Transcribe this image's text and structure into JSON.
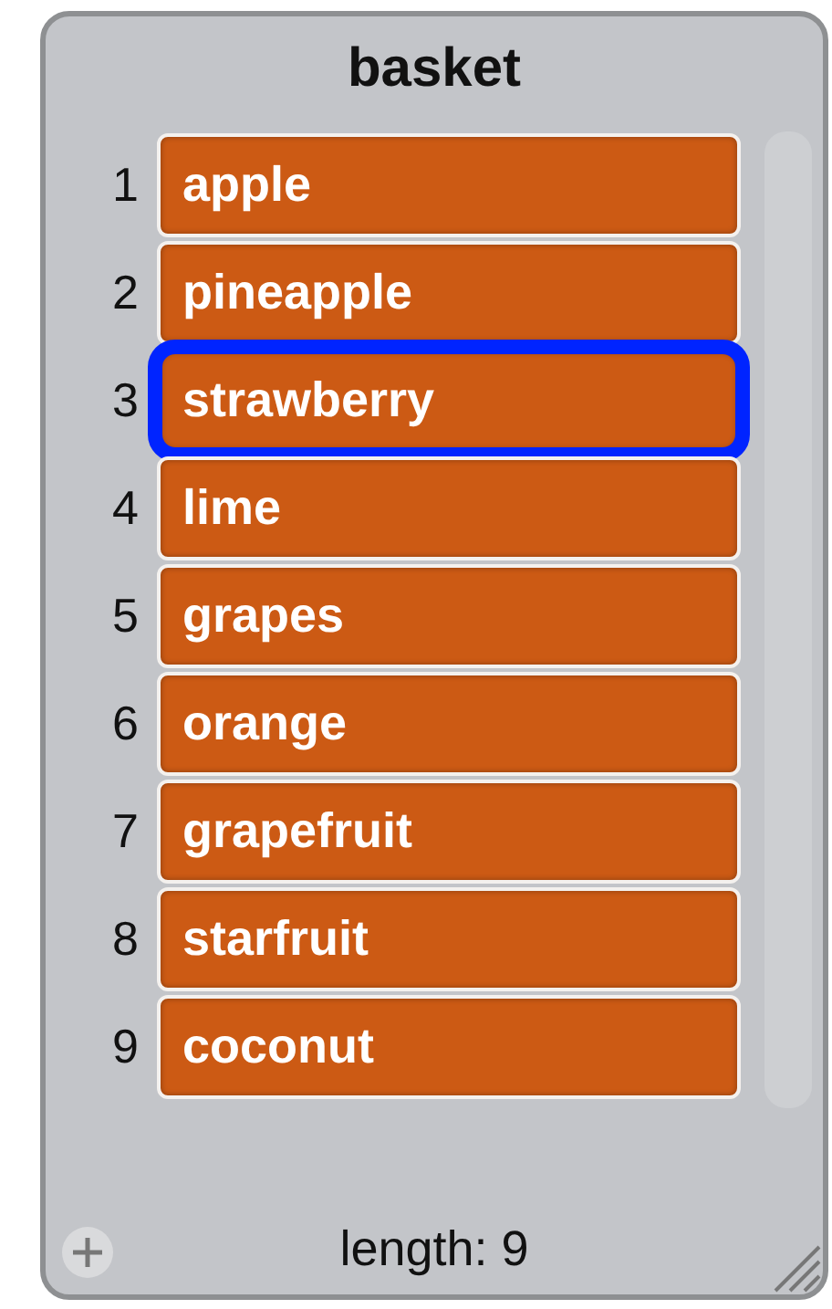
{
  "list_monitor": {
    "title": "basket",
    "items": [
      {
        "index": "1",
        "value": "apple",
        "selected": false
      },
      {
        "index": "2",
        "value": "pineapple",
        "selected": false
      },
      {
        "index": "3",
        "value": "strawberry",
        "selected": true
      },
      {
        "index": "4",
        "value": "lime",
        "selected": false
      },
      {
        "index": "5",
        "value": "grapes",
        "selected": false
      },
      {
        "index": "6",
        "value": "orange",
        "selected": false
      },
      {
        "index": "7",
        "value": "grapefruit",
        "selected": false
      },
      {
        "index": "8",
        "value": "starfruit",
        "selected": false
      },
      {
        "index": "9",
        "value": "coconut",
        "selected": false
      }
    ],
    "length_label": "length: 9"
  }
}
